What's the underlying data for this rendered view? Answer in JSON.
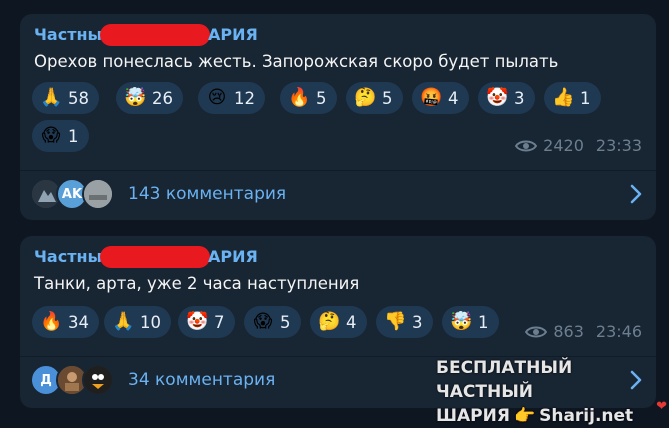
{
  "messages": [
    {
      "channel_left": "Частны",
      "channel_right": "АРИЯ",
      "text": "Орехов понеслась жесть. Запорожская скоро будет пылать",
      "reactions": [
        {
          "icon": "folded-hands",
          "glyph": "🙏",
          "count": "58"
        },
        {
          "icon": "exploding-head",
          "glyph": "🤯",
          "count": "26"
        },
        {
          "icon": "crying-face",
          "glyph": "😢",
          "count": "12"
        },
        {
          "icon": "fire",
          "glyph": "🔥",
          "count": "5"
        },
        {
          "icon": "thinking-face",
          "glyph": "🤔",
          "count": "5"
        },
        {
          "icon": "cursing-face",
          "glyph": "🤬",
          "count": "4"
        },
        {
          "icon": "clown-face",
          "glyph": "🤡",
          "count": "3"
        },
        {
          "icon": "thumbs-up",
          "glyph": "👍",
          "count": "1"
        },
        {
          "icon": "screaming-face",
          "glyph": "😱",
          "count": "1"
        }
      ],
      "views": "2420",
      "time": "23:33",
      "comments_label": "143 комментария",
      "avatars": [
        {
          "initials": "",
          "color": "#3b4a57"
        },
        {
          "initials": "AK",
          "color": "#5aa0d8"
        },
        {
          "initials": "",
          "color": "#8c9296"
        }
      ]
    },
    {
      "channel_left": "Частны",
      "channel_right": "АРИЯ",
      "text": "Танки, арта, уже 2 часа наступления",
      "reactions": [
        {
          "icon": "fire",
          "glyph": "🔥",
          "count": "34"
        },
        {
          "icon": "folded-hands",
          "glyph": "🙏",
          "count": "10"
        },
        {
          "icon": "clown-face",
          "glyph": "🤡",
          "count": "7"
        },
        {
          "icon": "screaming-face",
          "glyph": "😱",
          "count": "5"
        },
        {
          "icon": "thinking-face",
          "glyph": "🤔",
          "count": "4"
        },
        {
          "icon": "thumbs-down",
          "glyph": "👎",
          "count": "3"
        },
        {
          "icon": "exploding-head",
          "glyph": "🤯",
          "count": "1"
        }
      ],
      "views": "863",
      "time": "23:46",
      "comments_label": "34 комментария",
      "avatars": [
        {
          "initials": "Д",
          "color": "#4a90d9"
        },
        {
          "initials": "",
          "color": "#7a5a3c"
        },
        {
          "initials": "",
          "color": "#2b2b2b"
        }
      ]
    }
  ],
  "watermark": {
    "line1": "БЕСПЛАТНЫЙ ЧАСТНЫЙ",
    "line2a": "ШАРИЯ",
    "line2b": "Sharij.net",
    "hand_glyph": "👉"
  },
  "colors": {
    "background": "#0e1621",
    "bubble": "#182533",
    "reaction": "#1f3952",
    "accent": "#6ab2f2",
    "redaction": "#e8191f",
    "muted": "#6d7f8f"
  }
}
